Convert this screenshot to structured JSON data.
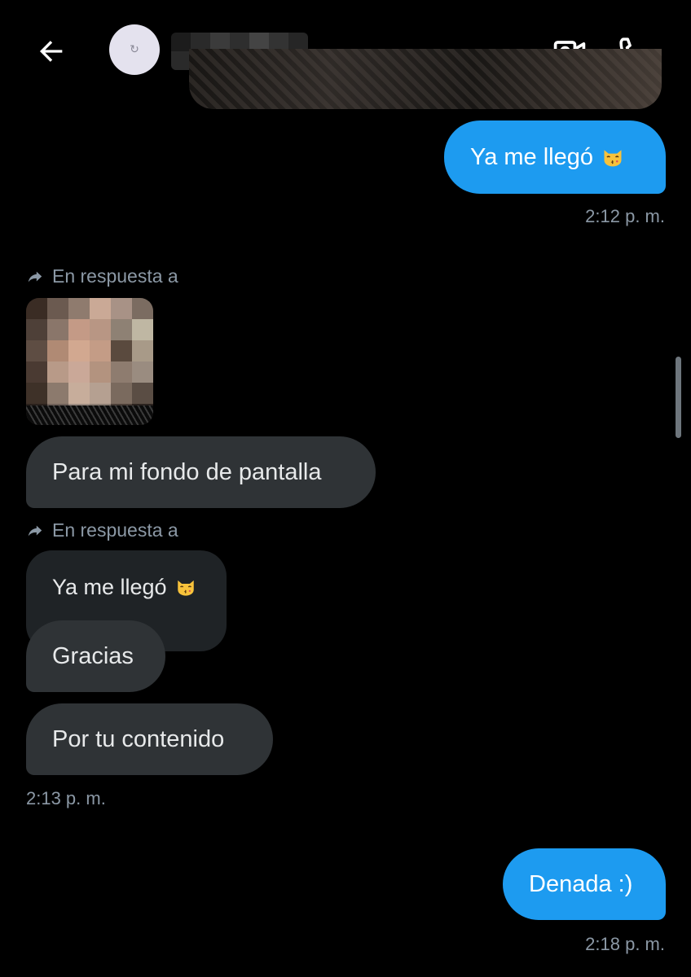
{
  "header": {
    "back_icon": "arrow-left-icon",
    "avatar_icon": "loading-spinner-icon",
    "avatar_glyph": "↻",
    "name_redacted": true,
    "video_icon": "video-camera-icon",
    "call_icon": "phone-icon"
  },
  "messages": {
    "out_1": {
      "text": "Ya me llegó",
      "emoji": "kissing-cat-emoji",
      "time": "2:12 p. m."
    },
    "reply_1": {
      "label": "En respuesta a",
      "icon": "reply-arrow-icon",
      "thumbnail": "pixelated-photo"
    },
    "in_1": {
      "text": "Para mi fondo de pantalla"
    },
    "reply_2": {
      "label": "En respuesta a",
      "icon": "reply-arrow-icon"
    },
    "quoted": {
      "text": "Ya me llegó",
      "emoji": "kissing-cat-emoji"
    },
    "in_2": {
      "text": "Gracias"
    },
    "in_3": {
      "text": "Por tu contenido",
      "time": "2:13 p. m."
    },
    "out_2": {
      "text": "Denada :)",
      "time": "2:18 p. m."
    }
  },
  "colors": {
    "background": "#000000",
    "outgoing_bubble": "#1d9bf0",
    "incoming_bubble": "#2f3336",
    "timestamp": "#8b98a5"
  }
}
